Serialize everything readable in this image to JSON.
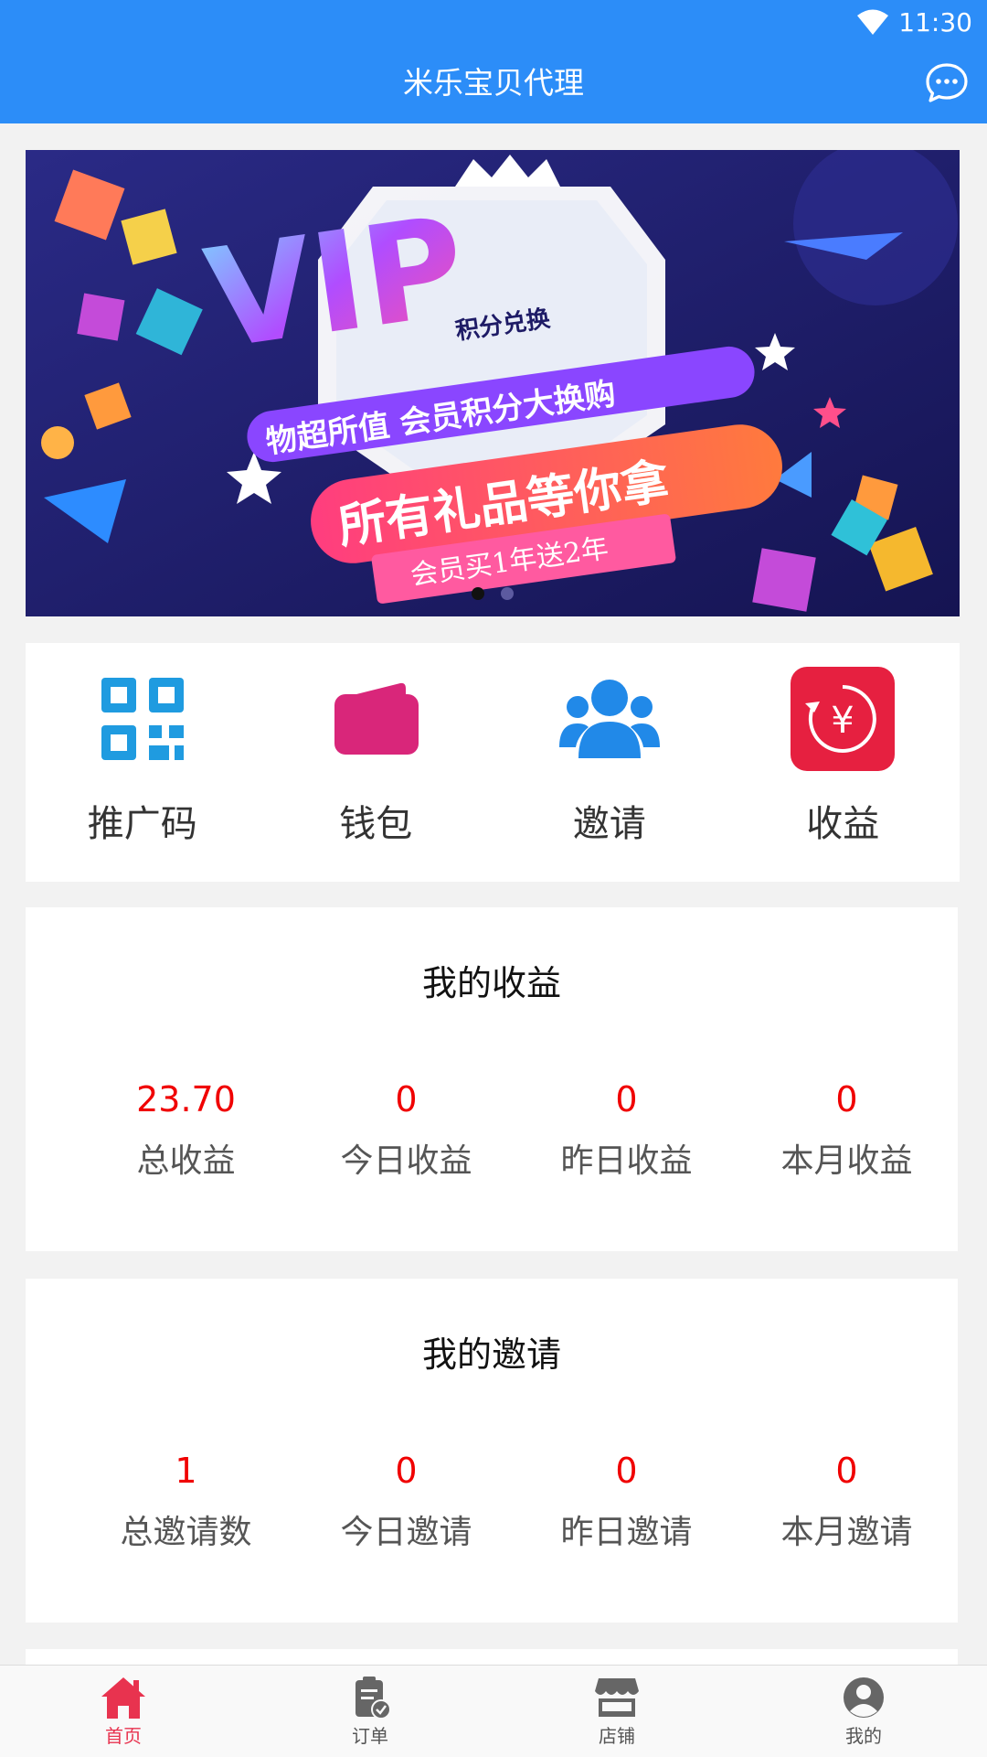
{
  "status": {
    "time": "11:30"
  },
  "header": {
    "title": "米乐宝贝代理"
  },
  "banner": {
    "headline": "VIP",
    "subhead": "积分兑换",
    "line1": "物超所值  会员积分大换购",
    "line2": "所有礼品等你拿",
    "ribbon": "会员买1年送2年",
    "colors": {
      "background": "#1e1b66",
      "accent": "#ff4f8b"
    }
  },
  "quick_actions": [
    {
      "label": "推广码",
      "icon": "qr-code-icon",
      "color": "#1f9be0"
    },
    {
      "label": "钱包",
      "icon": "wallet-icon",
      "color": "#d9267a"
    },
    {
      "label": "邀请",
      "icon": "users-icon",
      "color": "#2189e8"
    },
    {
      "label": "收益",
      "icon": "yen-exchange-icon",
      "color": "#e62040"
    }
  ],
  "earnings": {
    "title": "我的收益",
    "items": [
      {
        "value": "23.70",
        "label": "总收益"
      },
      {
        "value": "0",
        "label": "今日收益"
      },
      {
        "value": "0",
        "label": "昨日收益"
      },
      {
        "value": "0",
        "label": "本月收益"
      }
    ]
  },
  "invites": {
    "title": "我的邀请",
    "items": [
      {
        "value": "1",
        "label": "总邀请数"
      },
      {
        "value": "0",
        "label": "今日邀请"
      },
      {
        "value": "0",
        "label": "昨日邀请"
      },
      {
        "value": "0",
        "label": "本月邀请"
      }
    ]
  },
  "nav": [
    {
      "label": "首页",
      "icon": "home-icon",
      "active": true
    },
    {
      "label": "订单",
      "icon": "clipboard-check-icon",
      "active": false
    },
    {
      "label": "店铺",
      "icon": "store-icon",
      "active": false
    },
    {
      "label": "我的",
      "icon": "user-circle-icon",
      "active": false
    }
  ],
  "colors": {
    "primary": "#2c8df8",
    "value_red": "#f00000",
    "nav_active": "#e8334f"
  }
}
